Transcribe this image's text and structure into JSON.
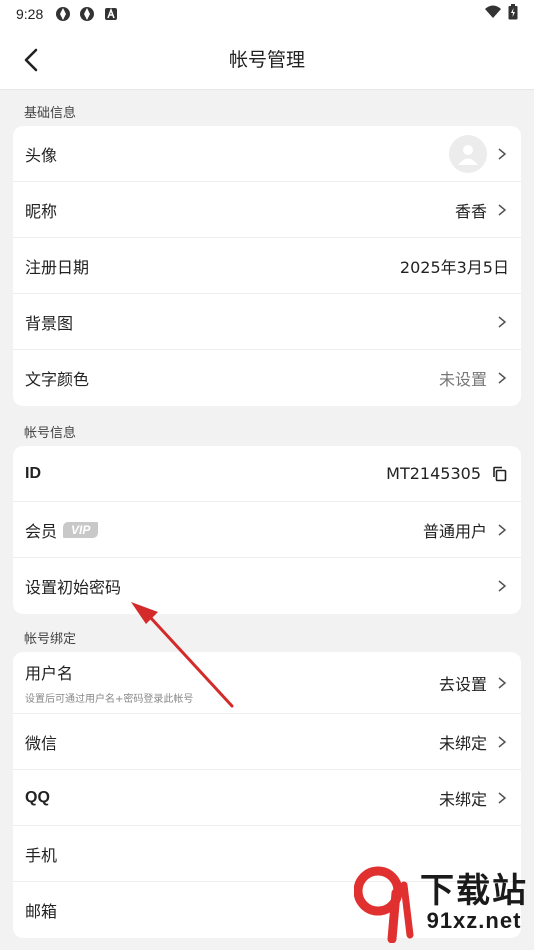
{
  "status_bar": {
    "time": "9:28"
  },
  "header": {
    "title": "帐号管理"
  },
  "sections": {
    "basic": {
      "label": "基础信息",
      "avatar_label": "头像",
      "nickname_label": "昵称",
      "nickname_value": "香香",
      "register_label": "注册日期",
      "register_value": "2025年3月5日",
      "background_label": "背景图",
      "text_color_label": "文字颜色",
      "text_color_value": "未设置"
    },
    "account": {
      "label": "帐号信息",
      "id_label": "ID",
      "id_value": "MT2145305",
      "member_label": "会员",
      "vip_badge": "VIP",
      "member_value": "普通用户",
      "password_label": "设置初始密码"
    },
    "binding": {
      "label": "帐号绑定",
      "username_label": "用户名",
      "username_hint": "设置后可通过用户名+密码登录此帐号",
      "username_value": "去设置",
      "wechat_label": "微信",
      "wechat_value": "未绑定",
      "qq_label": "QQ",
      "qq_value": "未绑定",
      "phone_label": "手机",
      "email_label": "邮箱"
    }
  },
  "watermark": {
    "brand": "下载站",
    "url": "91xz.net"
  },
  "colors": {
    "annotation_arrow": "#d42a2a",
    "watermark_red": "#e03030"
  }
}
